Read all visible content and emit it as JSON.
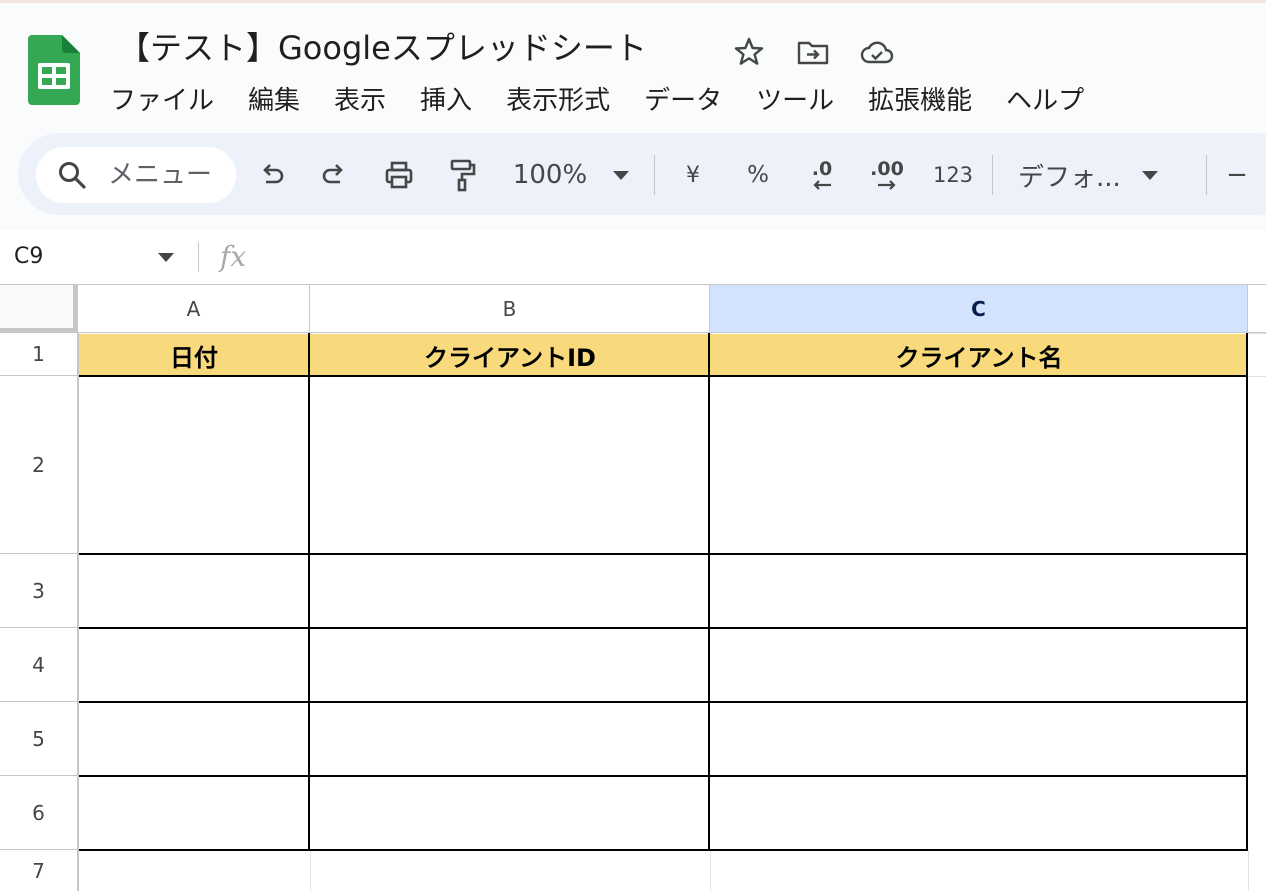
{
  "doc": {
    "title": "【テスト】Googleスプレッドシート"
  },
  "title_icons": [
    "star-icon",
    "move-folder-icon",
    "cloud-saved-icon"
  ],
  "menu": [
    "ファイル",
    "編集",
    "表示",
    "挿入",
    "表示形式",
    "データ",
    "ツール",
    "拡張機能",
    "ヘルプ"
  ],
  "toolbar": {
    "search_placeholder": "メニュー",
    "zoom": "100%",
    "currency": "¥",
    "percent": "%",
    "decrease_decimal": ".0",
    "increase_decimal": ".00",
    "number_format": "123",
    "font": "デフォ...",
    "minus": "−"
  },
  "formula_bar": {
    "cell_ref": "C9",
    "fx": "fx",
    "formula": ""
  },
  "columns": [
    "A",
    "B",
    "C"
  ],
  "selected_column": "C",
  "rows": [
    "1",
    "2",
    "3",
    "4",
    "5",
    "6",
    "7"
  ],
  "header_row": [
    "日付",
    "クライアントID",
    "クライアント名"
  ],
  "colors": {
    "header_fill": "#f8da7c",
    "selected_col": "#d3e3fd",
    "sheets_green": "#34a853"
  }
}
